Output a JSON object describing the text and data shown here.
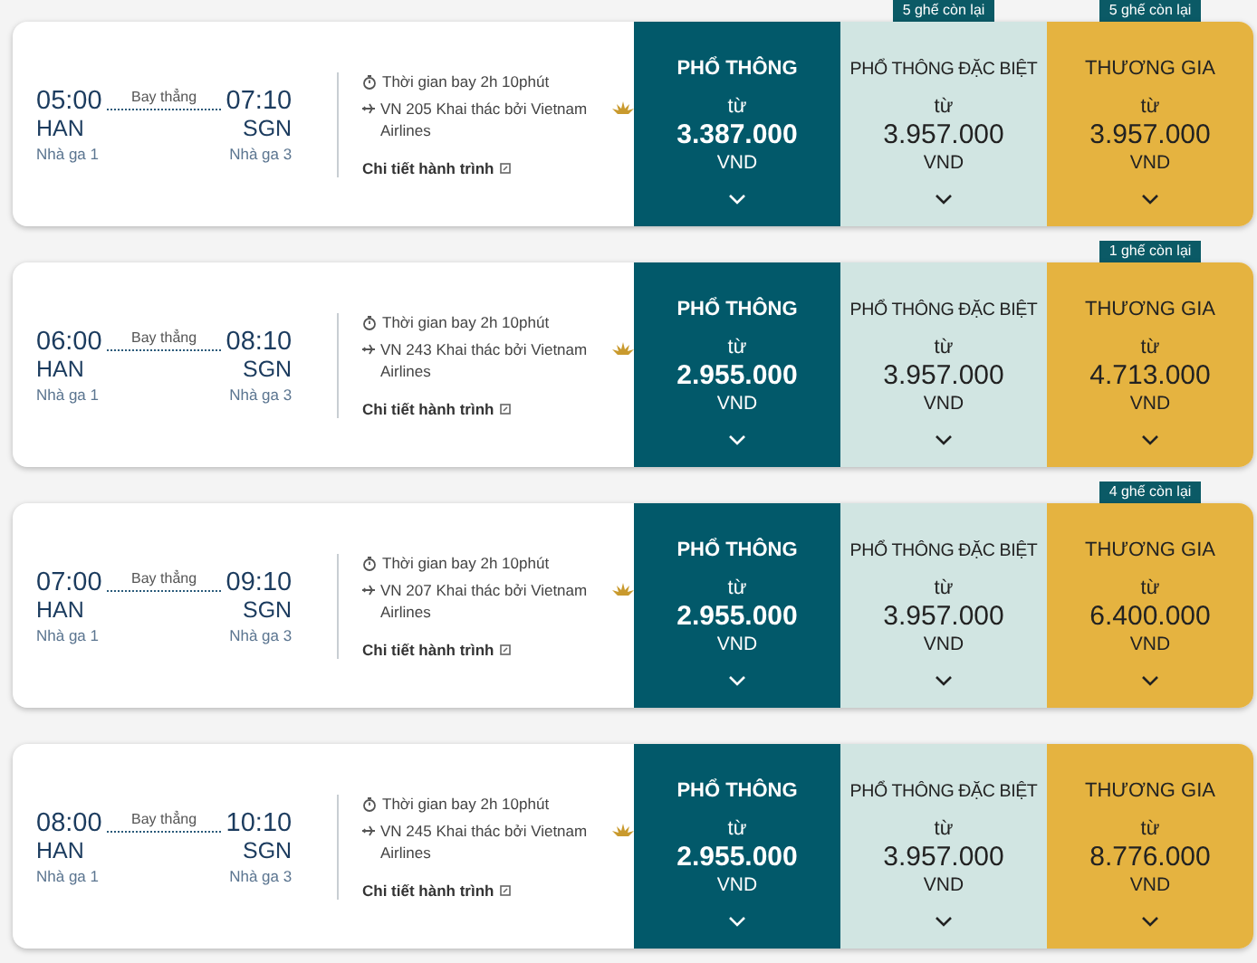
{
  "flights": [
    {
      "depart_time": "05:00",
      "depart_code": "HAN",
      "depart_terminal": "Nhà ga 1",
      "route_type": "Bay thẳng",
      "arrive_time": "07:10",
      "arrive_code": "SGN",
      "arrive_terminal": "Nhà ga 3",
      "duration": "Thời gian bay 2h 10phút",
      "flight_info": "VN 205 Khai thác bởi Vietnam Airlines",
      "details_link": "Chi tiết hành trình",
      "fares": [
        {
          "kind": "economy",
          "name": "PHỔ THÔNG",
          "from": "từ",
          "price": "3.387.000",
          "currency": "VND"
        },
        {
          "kind": "premium",
          "name": "PHỔ THÔNG ĐẶC BIỆT",
          "from": "từ",
          "price": "3.957.000",
          "currency": "VND",
          "seats_left": "5 ghế còn lại"
        },
        {
          "kind": "business",
          "name": "THƯƠNG GIA",
          "from": "từ",
          "price": "3.957.000",
          "currency": "VND",
          "seats_left": "5 ghế còn lại"
        }
      ]
    },
    {
      "depart_time": "06:00",
      "depart_code": "HAN",
      "depart_terminal": "Nhà ga 1",
      "route_type": "Bay thẳng",
      "arrive_time": "08:10",
      "arrive_code": "SGN",
      "arrive_terminal": "Nhà ga 3",
      "duration": "Thời gian bay 2h 10phút",
      "flight_info": "VN 243 Khai thác bởi Vietnam Airlines",
      "details_link": "Chi tiết hành trình",
      "fares": [
        {
          "kind": "economy",
          "name": "PHỔ THÔNG",
          "from": "từ",
          "price": "2.955.000",
          "currency": "VND"
        },
        {
          "kind": "premium",
          "name": "PHỔ THÔNG ĐẶC BIỆT",
          "from": "từ",
          "price": "3.957.000",
          "currency": "VND"
        },
        {
          "kind": "business",
          "name": "THƯƠNG GIA",
          "from": "từ",
          "price": "4.713.000",
          "currency": "VND",
          "seats_left": "1 ghế còn lại"
        }
      ]
    },
    {
      "depart_time": "07:00",
      "depart_code": "HAN",
      "depart_terminal": "Nhà ga 1",
      "route_type": "Bay thẳng",
      "arrive_time": "09:10",
      "arrive_code": "SGN",
      "arrive_terminal": "Nhà ga 3",
      "duration": "Thời gian bay 2h 10phút",
      "flight_info": "VN 207 Khai thác bởi Vietnam Airlines",
      "details_link": "Chi tiết hành trình",
      "fares": [
        {
          "kind": "economy",
          "name": "PHỔ THÔNG",
          "from": "từ",
          "price": "2.955.000",
          "currency": "VND"
        },
        {
          "kind": "premium",
          "name": "PHỔ THÔNG ĐẶC BIỆT",
          "from": "từ",
          "price": "3.957.000",
          "currency": "VND"
        },
        {
          "kind": "business",
          "name": "THƯƠNG GIA",
          "from": "từ",
          "price": "6.400.000",
          "currency": "VND",
          "seats_left": "4 ghế còn lại"
        }
      ]
    },
    {
      "depart_time": "08:00",
      "depart_code": "HAN",
      "depart_terminal": "Nhà ga 1",
      "route_type": "Bay thẳng",
      "arrive_time": "10:10",
      "arrive_code": "SGN",
      "arrive_terminal": "Nhà ga 3",
      "duration": "Thời gian bay 2h 10phút",
      "flight_info": "VN 245 Khai thác bởi Vietnam Airlines",
      "details_link": "Chi tiết hành trình",
      "fares": [
        {
          "kind": "economy",
          "name": "PHỔ THÔNG",
          "from": "từ",
          "price": "2.955.000",
          "currency": "VND"
        },
        {
          "kind": "premium",
          "name": "PHỔ THÔNG ĐẶC BIỆT",
          "from": "từ",
          "price": "3.957.000",
          "currency": "VND"
        },
        {
          "kind": "business",
          "name": "THƯƠNG GIA",
          "from": "từ",
          "price": "8.776.000",
          "currency": "VND"
        }
      ]
    }
  ]
}
